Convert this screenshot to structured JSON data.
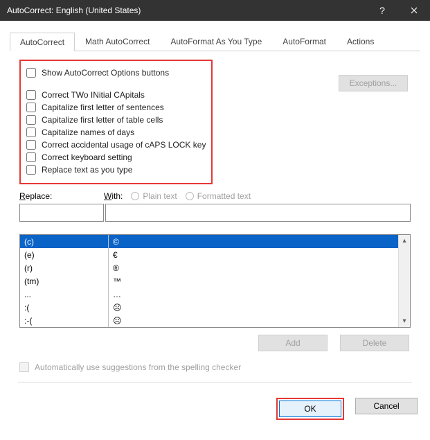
{
  "title": "AutoCorrect: English (United States)",
  "tabs": [
    "AutoCorrect",
    "Math AutoCorrect",
    "AutoFormat As You Type",
    "AutoFormat",
    "Actions"
  ],
  "active_tab": 0,
  "checks": {
    "show_buttons": "Show AutoCorrect Options buttons",
    "two_initial": "Correct TWo INitial CApitals",
    "cap_sentence": "Capitalize first letter of sentences",
    "cap_table": "Capitalize first letter of table cells",
    "cap_days": "Capitalize names of days",
    "caps_lock": "Correct accidental usage of cAPS LOCK key",
    "keyboard": "Correct keyboard setting",
    "replace_type": "Replace text as you type"
  },
  "exceptions_label": "Exceptions...",
  "replace_label": "Replace:",
  "with_label": "With:",
  "radio_plain": "Plain text",
  "radio_formatted": "Formatted text",
  "table_rows": [
    {
      "from": "(c)",
      "to": "©"
    },
    {
      "from": "(e)",
      "to": "€"
    },
    {
      "from": "(r)",
      "to": "®"
    },
    {
      "from": "(tm)",
      "to": "™"
    },
    {
      "from": "...",
      "to": "…"
    },
    {
      "from": ":(",
      "to": "☹"
    },
    {
      "from": ":-(",
      "to": "☹"
    }
  ],
  "selected_row": 0,
  "add_label": "Add",
  "delete_label": "Delete",
  "auto_suggest": "Automatically use suggestions from the spelling checker",
  "ok_label": "OK",
  "cancel_label": "Cancel"
}
